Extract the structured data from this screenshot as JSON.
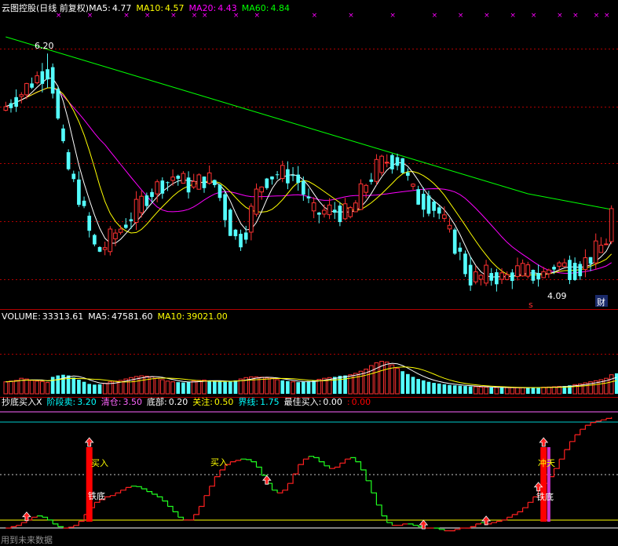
{
  "header": {
    "title": "云图控股(日线 前复权)",
    "items": [
      {
        "label": "MA5:",
        "value": "4.77",
        "color": "#ffffff"
      },
      {
        "label": "MA10:",
        "value": "4.57",
        "color": "#ffff00"
      },
      {
        "label": "MA20:",
        "value": "4.43",
        "color": "#ff00ff"
      },
      {
        "label": "MA60:",
        "value": "4.84",
        "color": "#00ff00"
      }
    ]
  },
  "volume_header": {
    "items": [
      {
        "label": "VOLUME:",
        "value": "33313.61",
        "color": "#ffffff"
      },
      {
        "label": "MA5:",
        "value": "47581.60",
        "color": "#ffffff"
      },
      {
        "label": "MA10:",
        "value": "39021.00",
        "color": "#ffff00"
      }
    ]
  },
  "indicator_header": {
    "items": [
      {
        "label": "抄底买入X",
        "value": "",
        "color": "#ffffff"
      },
      {
        "label": "阶段卖:",
        "value": "3.20",
        "color": "#00ffff"
      },
      {
        "label": "清仓:",
        "value": "3.50",
        "color": "#ff66ff"
      },
      {
        "label": "底部:",
        "value": "0.20",
        "color": "#ffffff"
      },
      {
        "label": "关注:",
        "value": "0.50",
        "color": "#ffff00"
      },
      {
        "label": "界线:",
        "value": "1.75",
        "color": "#00ffff"
      },
      {
        "label": "最佳买入:",
        "value": "0.00",
        "color": "#ffffff"
      },
      {
        "label": ":",
        "value": "0.00",
        "color": "#ff0000"
      }
    ]
  },
  "annotations": {
    "high_label": "6.20",
    "low_label": "4.09",
    "cai_badge": "财",
    "s_mark": "s",
    "buy1": "买入",
    "buy2": "买入",
    "bottom1": "铁底",
    "bottom2": "铁底",
    "chongtian": "冲天",
    "footer": "用到未来数据"
  },
  "colors": {
    "up": "#ff3232",
    "down": "#54ffff",
    "ma5": "#ffffff",
    "ma10": "#ffff00",
    "ma20": "#ff00ff",
    "ma60": "#00ff00",
    "grid": "#b00000",
    "xmark": "#ff00ff",
    "osc_up": "#ff2020",
    "osc_down": "#20ff20"
  },
  "chart_data": [
    {
      "type": "candlestick",
      "title": "云图控股(日线 前复权)",
      "ylim": [
        3.95,
        6.75
      ],
      "x_count": 117,
      "close": [
        5.84,
        5.88,
        5.93,
        5.98,
        6.04,
        6.09,
        6.14,
        6.17,
        6.2,
        6.04,
        5.68,
        5.38,
        5.19,
        5.04,
        4.93,
        4.74,
        4.55,
        4.4,
        4.37,
        4.42,
        4.49,
        4.55,
        4.6,
        4.66,
        4.72,
        4.79,
        4.87,
        4.93,
        4.98,
        5.02,
        5.06,
        5.08,
        5.13,
        5.11,
        5.07,
        5.04,
        5.04,
        5.07,
        5.1,
        5.09,
        5.04,
        4.91,
        4.74,
        4.6,
        4.49,
        4.49,
        4.59,
        4.77,
        4.95,
        5.05,
        5.1,
        5.14,
        5.16,
        5.15,
        5.14,
        5.14,
        5.07,
        4.96,
        4.84,
        4.75,
        4.75,
        4.77,
        4.78,
        4.77,
        4.76,
        4.74,
        4.77,
        4.85,
        4.95,
        5.06,
        5.13,
        5.21,
        5.26,
        5.29,
        5.29,
        5.29,
        5.2,
        5.08,
        4.96,
        4.9,
        4.87,
        4.85,
        4.81,
        4.75,
        4.65,
        4.53,
        4.43,
        4.31,
        4.18,
        4.09,
        4.09,
        4.1,
        4.12,
        4.1,
        4.11,
        4.09,
        4.1,
        4.14,
        4.16,
        4.16,
        4.14,
        4.12,
        4.11,
        4.13,
        4.18,
        4.22,
        4.23,
        4.21,
        4.18,
        4.18,
        4.2,
        4.26,
        4.31,
        4.36,
        4.41,
        4.48,
        4.77
      ],
      "open": [
        5.8,
        5.84,
        5.88,
        5.93,
        5.98,
        6.04,
        6.09,
        6.14,
        6.17,
        6.2,
        6.04,
        5.68,
        5.38,
        5.19,
        5.04,
        4.93,
        4.74,
        4.55,
        4.4,
        4.37,
        4.42,
        4.49,
        4.55,
        4.6,
        4.66,
        4.72,
        4.79,
        4.87,
        4.93,
        4.98,
        5.02,
        5.06,
        5.08,
        5.13,
        5.11,
        5.07,
        5.04,
        5.04,
        5.07,
        5.1,
        5.09,
        5.04,
        4.91,
        4.74,
        4.6,
        4.49,
        4.49,
        4.59,
        4.77,
        4.95,
        5.05,
        5.1,
        5.14,
        5.16,
        5.15,
        5.14,
        5.14,
        5.07,
        4.96,
        4.84,
        4.75,
        4.75,
        4.77,
        4.78,
        4.77,
        4.76,
        4.74,
        4.77,
        4.85,
        4.95,
        5.06,
        5.13,
        5.21,
        5.26,
        5.29,
        5.29,
        5.29,
        5.2,
        5.08,
        4.96,
        4.9,
        4.87,
        4.85,
        4.81,
        4.75,
        4.65,
        4.53,
        4.43,
        4.31,
        4.18,
        4.09,
        4.09,
        4.1,
        4.12,
        4.1,
        4.11,
        4.09,
        4.1,
        4.14,
        4.16,
        4.16,
        4.14,
        4.12,
        4.11,
        4.13,
        4.18,
        4.22,
        4.23,
        4.21,
        4.18,
        4.18,
        4.2,
        4.26,
        4.31,
        4.36,
        4.41,
        4.48
      ],
      "series": [
        {
          "name": "MA5",
          "value": "4.77"
        },
        {
          "name": "MA10",
          "value": "4.57"
        },
        {
          "name": "MA20",
          "value": "4.43"
        },
        {
          "name": "MA60",
          "value": "4.84"
        }
      ],
      "annotations": [
        "6.20",
        "4.09"
      ]
    },
    {
      "type": "bar",
      "title": "VOLUME",
      "ylim": [
        0,
        100000
      ],
      "values": [
        17000,
        18000,
        19000,
        22000,
        21000,
        19000,
        18000,
        17500,
        16000,
        24000,
        26000,
        27000,
        26000,
        23000,
        20000,
        17000,
        14000,
        13000,
        13500,
        15000,
        17000,
        18000,
        19000,
        21000,
        23000,
        24500,
        25500,
        25000,
        24000,
        22000,
        20000,
        18000,
        17000,
        16500,
        16000,
        16500,
        18000,
        19000,
        19500,
        19000,
        18000,
        17500,
        17000,
        17500,
        19000,
        21000,
        23000,
        24000,
        24000,
        23500,
        22500,
        22000,
        20000,
        19000,
        18000,
        17000,
        16500,
        17000,
        18000,
        19000,
        20500,
        22000,
        23000,
        24000,
        25500,
        26000,
        27000,
        29000,
        32000,
        35000,
        40000,
        44000,
        46000,
        45000,
        41000,
        36000,
        32000,
        28000,
        24000,
        21000,
        19000,
        17000,
        15500,
        14500,
        13500,
        12500,
        12000,
        11500,
        11000,
        10500,
        10000,
        9500,
        9300,
        9100,
        8900,
        8800,
        8700,
        8700,
        8600,
        8700,
        8800,
        9000,
        9200,
        9400,
        9600,
        10000,
        10400,
        11000,
        12000,
        13000,
        14000,
        15500,
        17000,
        18500,
        20000,
        22000,
        27000,
        29000
      ],
      "series": [
        {
          "name": "VOLUME",
          "value": "33313.61"
        },
        {
          "name": "MA5",
          "value": "47581.60"
        },
        {
          "name": "MA10",
          "value": "39021.00"
        }
      ]
    },
    {
      "type": "line",
      "title": "抄底买入X",
      "ylim": [
        -0.15,
        4.2
      ],
      "values": [
        0.05,
        0.1,
        0.15,
        0.25,
        0.35,
        0.45,
        0.5,
        0.45,
        0.35,
        0.2,
        0.1,
        0.05,
        0.08,
        0.15,
        0.3,
        0.55,
        0.8,
        1.0,
        1.1,
        1.2,
        1.25,
        1.35,
        1.45,
        1.55,
        1.6,
        1.58,
        1.5,
        1.4,
        1.3,
        1.2,
        1.05,
        0.85,
        0.65,
        0.45,
        0.35,
        0.35,
        0.55,
        0.85,
        1.25,
        1.6,
        1.95,
        2.2,
        2.4,
        2.5,
        2.55,
        2.6,
        2.58,
        2.5,
        2.3,
        2.0,
        1.7,
        1.45,
        1.35,
        1.45,
        1.7,
        2.05,
        2.4,
        2.6,
        2.7,
        2.65,
        2.5,
        2.35,
        2.25,
        2.3,
        2.45,
        2.6,
        2.65,
        2.5,
        2.2,
        1.8,
        1.35,
        0.9,
        0.5,
        0.25,
        0.15,
        0.15,
        0.2,
        0.2,
        0.15,
        0.1,
        0.05,
        0.05,
        0.05,
        0.0,
        -0.05,
        -0.05,
        0.0,
        0.05,
        0.05,
        0.1,
        0.2,
        0.25,
        0.2,
        0.25,
        0.3,
        0.35,
        0.45,
        0.55,
        0.65,
        0.8,
        1.0,
        1.2,
        1.45,
        1.7,
        1.95,
        2.25,
        2.6,
        2.95,
        3.25,
        3.5,
        3.7,
        3.85,
        3.95,
        4.0,
        4.05,
        4.1,
        4.15
      ],
      "series": [
        {
          "name": "阶段卖",
          "value": "3.20"
        },
        {
          "name": "清仓",
          "value": "3.50"
        },
        {
          "name": "底部",
          "value": "0.20"
        },
        {
          "name": "关注",
          "value": "0.50"
        },
        {
          "name": "界线",
          "value": "1.75"
        },
        {
          "name": "最佳买入",
          "value": "0.00"
        }
      ]
    }
  ]
}
